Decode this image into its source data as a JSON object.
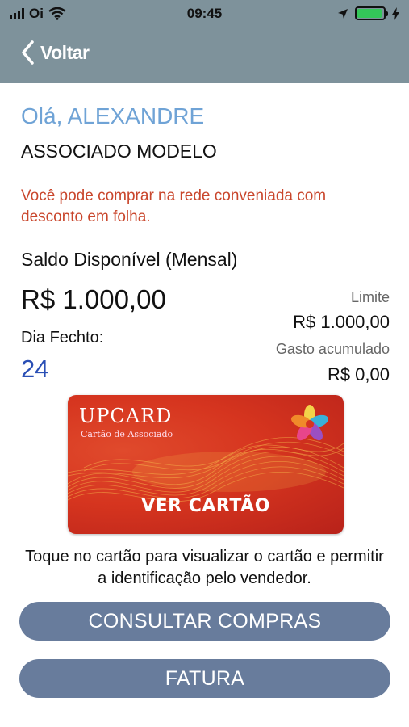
{
  "status_bar": {
    "carrier": "Oi",
    "time": "09:45",
    "icons": [
      "signal-icon",
      "wifi-icon",
      "location-icon",
      "battery-icon",
      "charging-icon"
    ],
    "battery_level": 0.95
  },
  "nav": {
    "back_label": "Voltar"
  },
  "user": {
    "greeting": "Olá, ALEXANDRE",
    "plan": "ASSOCIADO MODELO",
    "discount_message": "Você pode comprar na rede conveniada com desconto em folha."
  },
  "balance": {
    "label": "Saldo Disponível (Mensal)",
    "value": "R$ 1.000,00",
    "closing_label": "Dia Fechto:",
    "closing_day": "24",
    "limit_label": "Limite",
    "limit_value": "R$ 1.000,00",
    "spent_label": "Gasto acumulado",
    "spent_value": "R$ 0,00"
  },
  "card": {
    "brand": "UPCARD",
    "subtitle": "Cartão de Associado",
    "cta": "VER CARTÃO",
    "hint": "Toque no cartão para visualizar o cartão e permitir a identificação pelo vendedor."
  },
  "actions": {
    "purchases_label": "CONSULTAR COMPRAS",
    "invoice_label": "FATURA"
  },
  "colors": {
    "header": "#7e929b",
    "greeting": "#6fa3d6",
    "alert": "#c9462c",
    "closing_day": "#2a4fb5",
    "button": "#687c9c",
    "card": "#d6351f"
  }
}
